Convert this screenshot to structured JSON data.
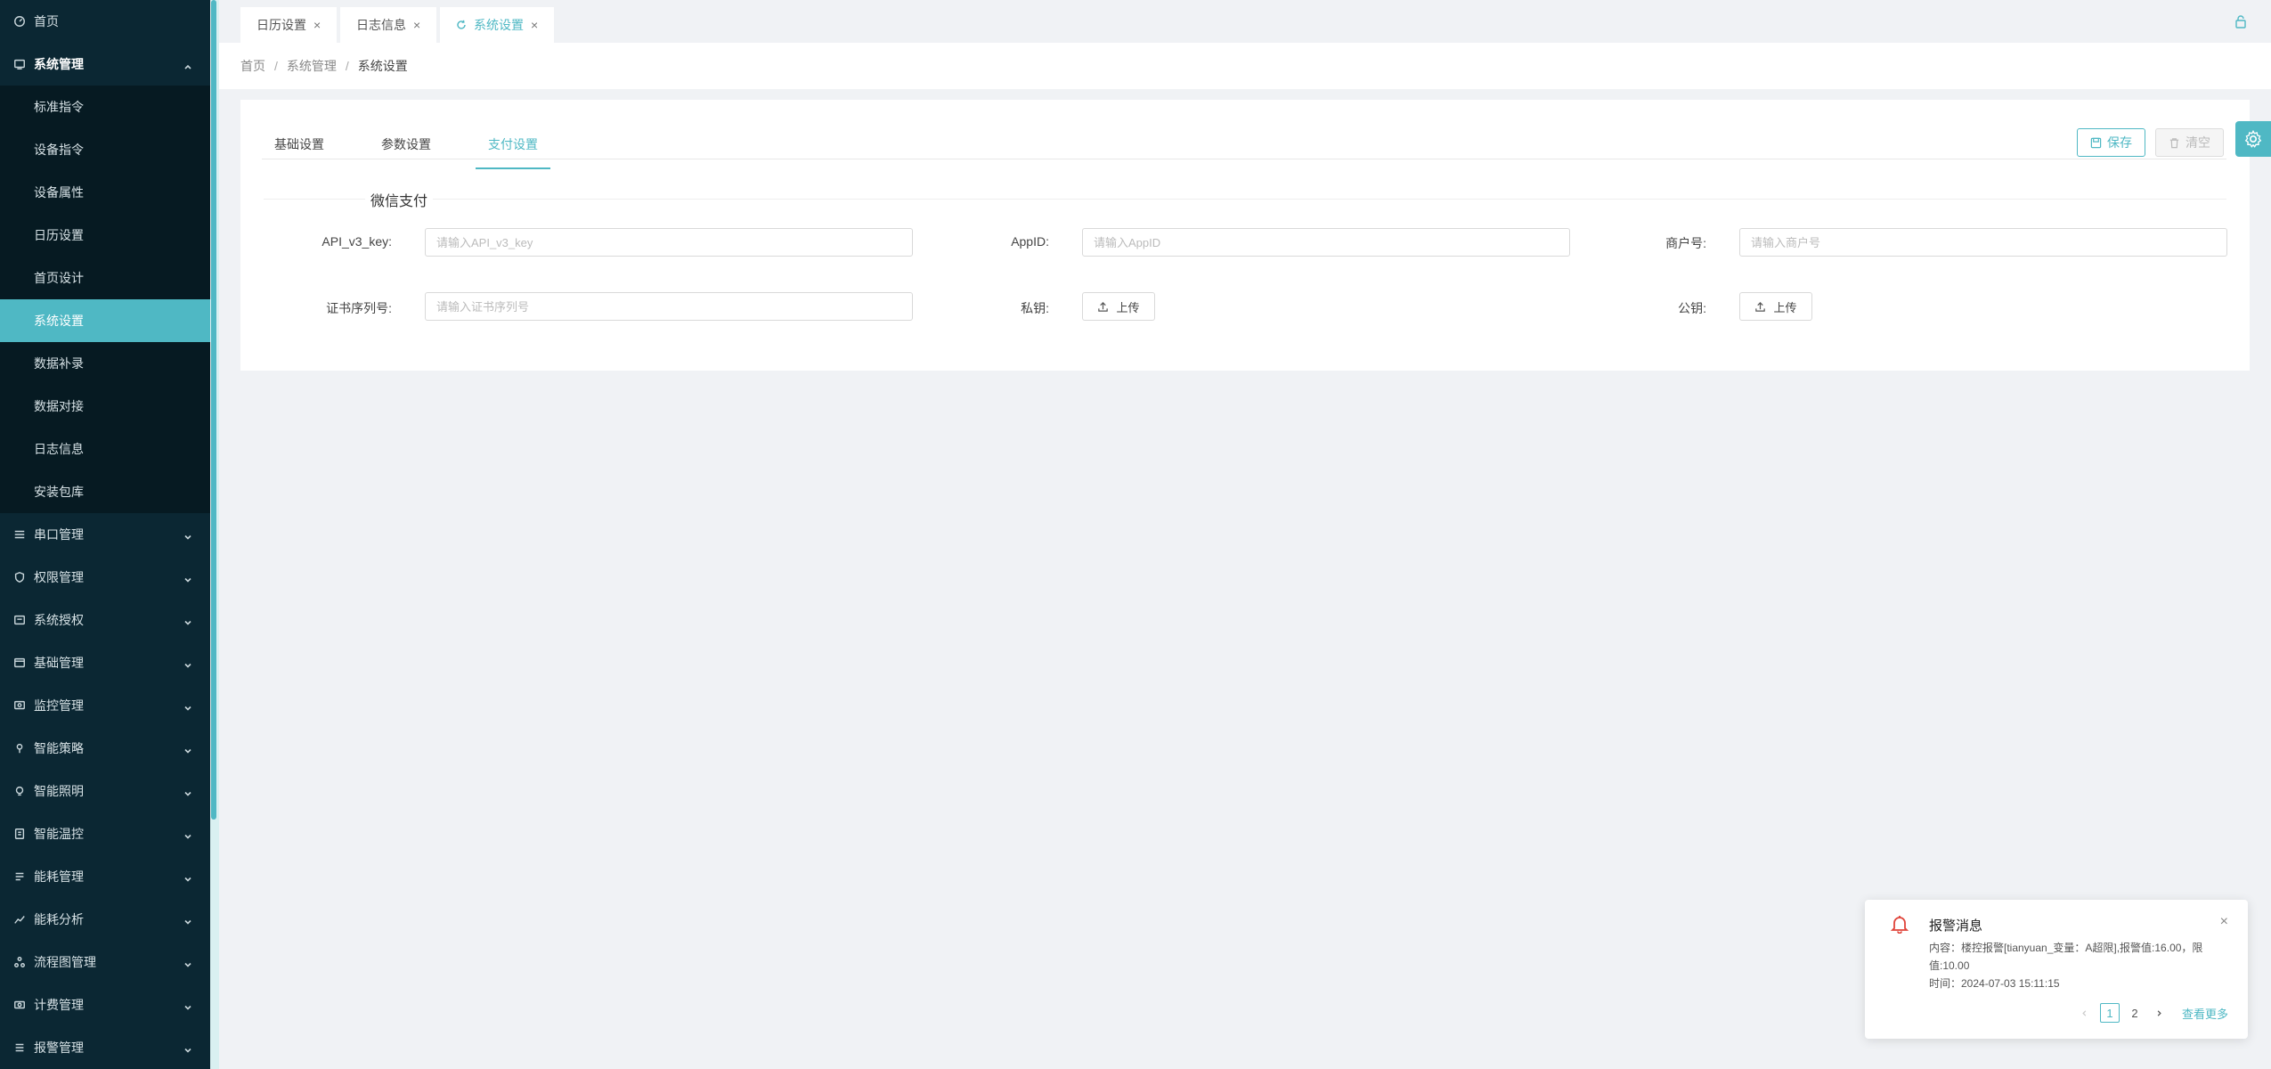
{
  "sidebar": {
    "home": {
      "label": "首页",
      "icon": "dashboard-icon"
    },
    "open_group": {
      "label": "系统管理",
      "icon": "system-manage-icon"
    },
    "submenu": [
      {
        "label": "标准指令"
      },
      {
        "label": "设备指令"
      },
      {
        "label": "设备属性"
      },
      {
        "label": "日历设置"
      },
      {
        "label": "首页设计"
      },
      {
        "label": "系统设置",
        "active": true
      },
      {
        "label": "数据补录"
      },
      {
        "label": "数据对接"
      },
      {
        "label": "日志信息"
      },
      {
        "label": "安装包库"
      }
    ],
    "groups": [
      {
        "label": "串口管理"
      },
      {
        "label": "权限管理"
      },
      {
        "label": "系统授权"
      },
      {
        "label": "基础管理"
      },
      {
        "label": "监控管理"
      },
      {
        "label": "智能策略"
      },
      {
        "label": "智能照明"
      },
      {
        "label": "智能温控"
      },
      {
        "label": "能耗管理"
      },
      {
        "label": "能耗分析"
      },
      {
        "label": "流程图管理"
      },
      {
        "label": "计费管理"
      },
      {
        "label": "报警管理"
      }
    ]
  },
  "tabs": [
    {
      "label": "日历设置",
      "close": "×"
    },
    {
      "label": "日志信息",
      "close": "×"
    },
    {
      "label": "系统设置",
      "close": "×"
    }
  ],
  "breadcrumb": {
    "items": [
      "首页",
      "系统管理",
      "系统设置"
    ],
    "sep": "/"
  },
  "settings": {
    "subtabs": [
      "基础设置",
      "参数设置",
      "支付设置"
    ],
    "save_label": "保存",
    "clear_label": "清空",
    "section_title": "微信支付",
    "fields": {
      "api_key": {
        "label": "API_v3_key:",
        "placeholder": "请输入API_v3_key"
      },
      "appid": {
        "label": "AppID:",
        "placeholder": "请输入AppID"
      },
      "merchant": {
        "label": "商户号:",
        "placeholder": "请输入商户号"
      },
      "cert_serial": {
        "label": "证书序列号:",
        "placeholder": "请输入证书序列号"
      },
      "private_key": {
        "label": "私钥:",
        "button": "上传"
      },
      "public_key": {
        "label": "公钥:",
        "button": "上传"
      }
    }
  },
  "notification": {
    "title": "报警消息",
    "close": "×",
    "content": "内容：楼控报警[tianyuan_变量：A超限],报警值:16.00，限值:10.00",
    "time": "时间：2024-07-03 15:11:15",
    "pages": [
      "1",
      "2"
    ],
    "more": "查看更多"
  },
  "colors": {
    "accent": "#4fb8c4",
    "sidebar": "#0b2733",
    "alarm": "#e0443a"
  }
}
